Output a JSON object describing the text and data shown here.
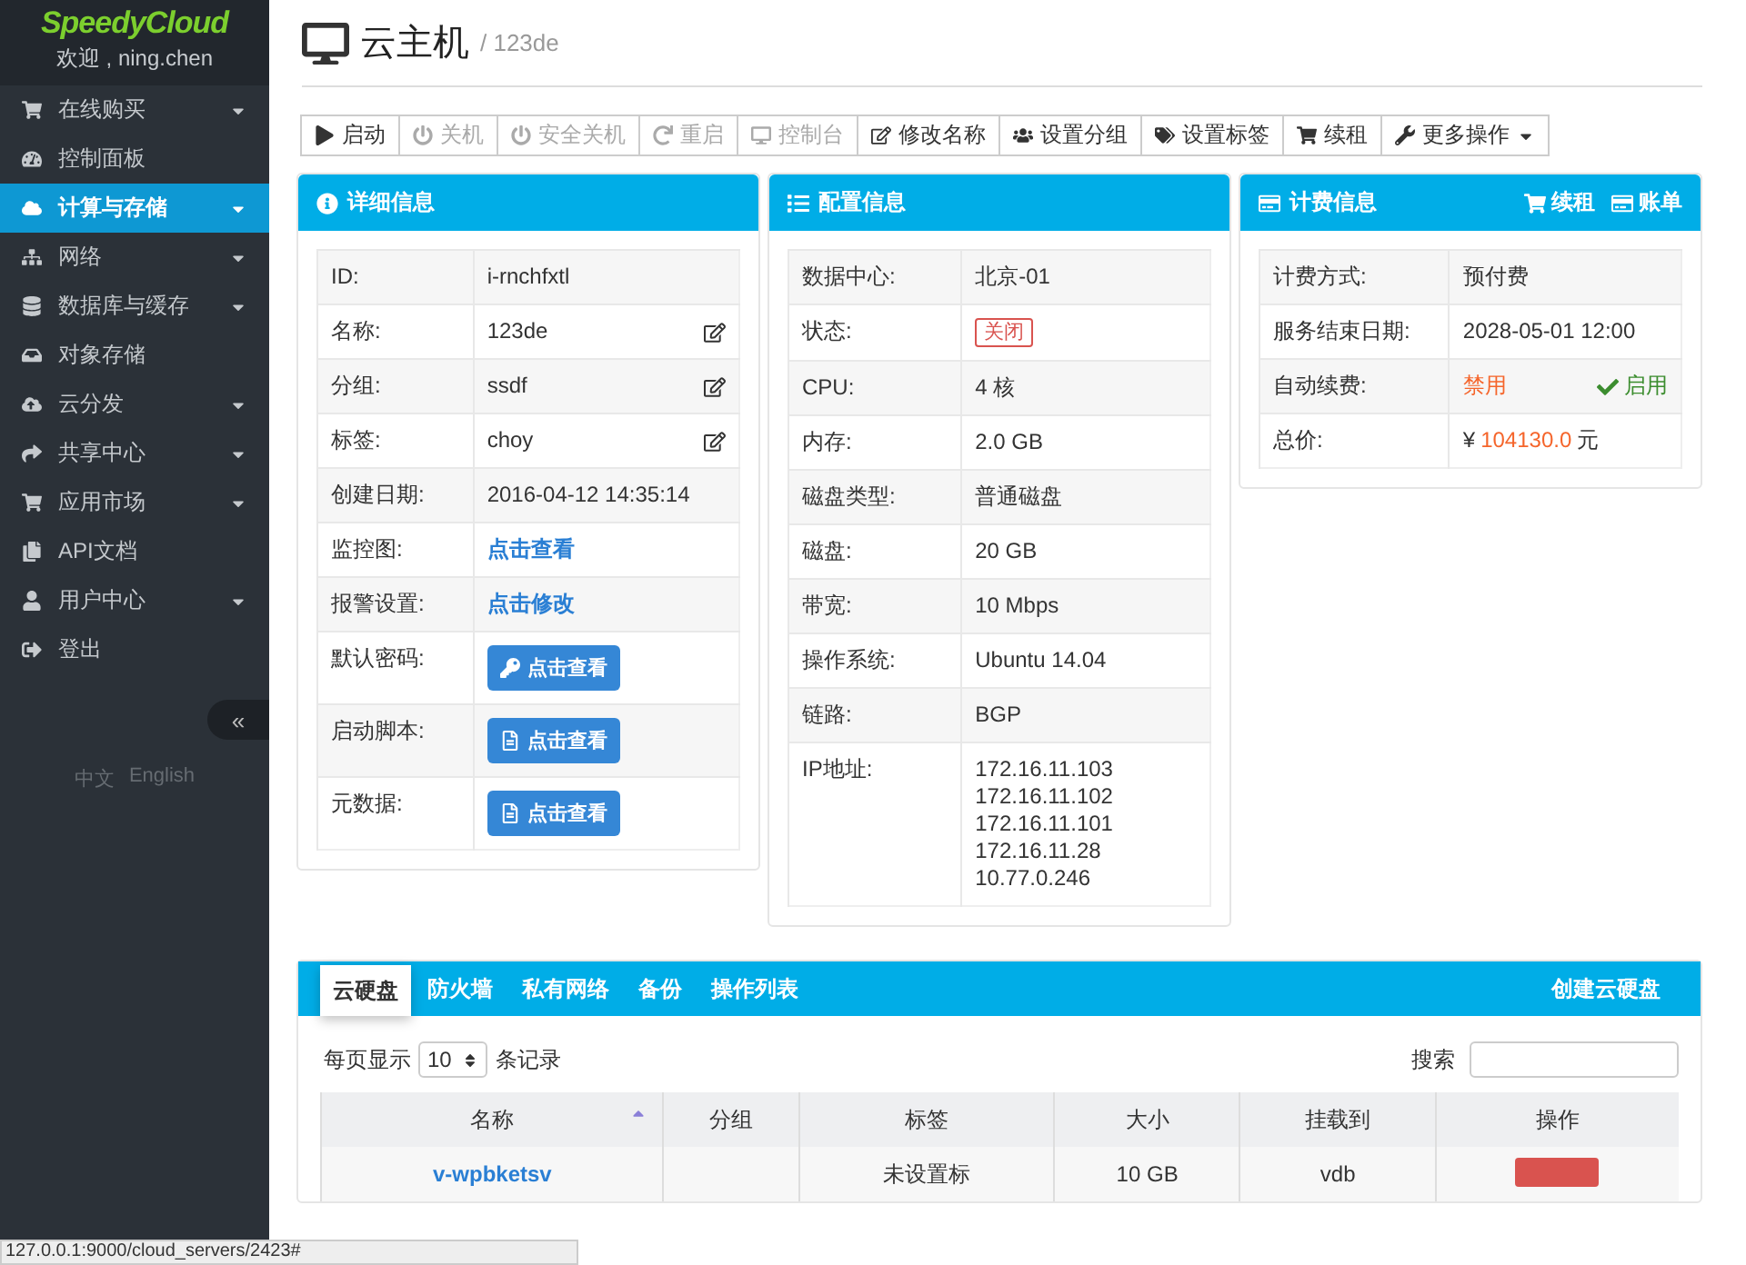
{
  "sidebar": {
    "logo": "SpeedyCloud",
    "welcome": "欢迎 , ning.chen",
    "items": [
      {
        "label": "在线购买",
        "expandable": true,
        "selected": false
      },
      {
        "label": "控制面板",
        "expandable": false,
        "selected": false
      },
      {
        "label": "计算与存储",
        "expandable": true,
        "selected": true
      },
      {
        "label": "网络",
        "expandable": true,
        "selected": false
      },
      {
        "label": "数据库与缓存",
        "expandable": true,
        "selected": false
      },
      {
        "label": "对象存储",
        "expandable": false,
        "selected": false
      },
      {
        "label": "云分发",
        "expandable": true,
        "selected": false
      },
      {
        "label": "共享中心",
        "expandable": true,
        "selected": false
      },
      {
        "label": "应用市场",
        "expandable": true,
        "selected": false
      },
      {
        "label": "API文档",
        "expandable": false,
        "selected": false
      },
      {
        "label": "用户中心",
        "expandable": true,
        "selected": false
      },
      {
        "label": "登出",
        "expandable": false,
        "selected": false
      }
    ],
    "collapse": "«",
    "languages": [
      "中文",
      "English"
    ]
  },
  "header": {
    "title": "云主机",
    "subtitle": "/ 123de"
  },
  "toolbar": [
    {
      "label": "启动",
      "disabled": false
    },
    {
      "label": "关机",
      "disabled": true
    },
    {
      "label": "安全关机",
      "disabled": true
    },
    {
      "label": "重启",
      "disabled": true
    },
    {
      "label": "控制台",
      "disabled": true
    },
    {
      "label": "修改名称",
      "disabled": false
    },
    {
      "label": "设置分组",
      "disabled": false
    },
    {
      "label": "设置标签",
      "disabled": false
    },
    {
      "label": "续租",
      "disabled": false
    },
    {
      "label": "更多操作",
      "disabled": false
    }
  ],
  "detail": {
    "title": "详细信息",
    "rows": [
      {
        "label": "ID:",
        "value": "i-rnchfxtl",
        "kind": "text"
      },
      {
        "label": "名称:",
        "value": "123de",
        "kind": "editable"
      },
      {
        "label": "分组:",
        "value": "ssdf",
        "kind": "editable"
      },
      {
        "label": "标签:",
        "value": "choy",
        "kind": "editable"
      },
      {
        "label": "创建日期:",
        "value": "2016-04-12 14:35:14",
        "kind": "text"
      },
      {
        "label": "监控图:",
        "value": "点击查看",
        "kind": "link"
      },
      {
        "label": "报警设置:",
        "value": "点击修改",
        "kind": "link"
      },
      {
        "label": "默认密码:",
        "value": "点击查看",
        "kind": "key-button"
      },
      {
        "label": "启动脚本:",
        "value": "点击查看",
        "kind": "file-button"
      },
      {
        "label": "元数据:",
        "value": "点击查看",
        "kind": "file-button"
      }
    ]
  },
  "config": {
    "title": "配置信息",
    "rows": [
      {
        "label": "数据中心:",
        "values": [
          "北京-01"
        ],
        "kind": "text"
      },
      {
        "label": "状态:",
        "values": [
          "关闭"
        ],
        "kind": "status"
      },
      {
        "label": "CPU:",
        "values": [
          "4 核"
        ],
        "kind": "text"
      },
      {
        "label": "内存:",
        "values": [
          "2.0 GB"
        ],
        "kind": "text"
      },
      {
        "label": "磁盘类型:",
        "values": [
          "普通磁盘"
        ],
        "kind": "text"
      },
      {
        "label": "磁盘:",
        "values": [
          "20 GB"
        ],
        "kind": "text"
      },
      {
        "label": "带宽:",
        "values": [
          "10 Mbps"
        ],
        "kind": "text"
      },
      {
        "label": "操作系统:",
        "values": [
          "Ubuntu 14.04"
        ],
        "kind": "text"
      },
      {
        "label": "链路:",
        "values": [
          "BGP"
        ],
        "kind": "text"
      },
      {
        "label": "IP地址:",
        "values": [
          "172.16.11.103",
          "172.16.11.102",
          "172.16.11.101",
          "172.16.11.28",
          "10.77.0.246"
        ],
        "kind": "text"
      }
    ]
  },
  "billing": {
    "title": "计费信息",
    "actions": [
      "续租",
      "账单"
    ],
    "rows": [
      {
        "label": "计费方式:",
        "value": "预付费",
        "kind": "text"
      },
      {
        "label": "服务结束日期:",
        "value": "2028-05-01 12:00",
        "kind": "text"
      },
      {
        "label": "自动续费:",
        "value": "禁用",
        "kind": "toggle",
        "toggle": "启用"
      },
      {
        "label": "总价:",
        "value": "104130.0",
        "kind": "price",
        "prefix": "¥",
        "suffix": "元"
      }
    ]
  },
  "disks": {
    "tabs": [
      {
        "label": "云硬盘",
        "selected": true
      },
      {
        "label": "防火墙",
        "selected": false
      },
      {
        "label": "私有网络",
        "selected": false
      },
      {
        "label": "备份",
        "selected": false
      },
      {
        "label": "操作列表",
        "selected": false
      }
    ],
    "create": "创建云硬盘",
    "length_before": "每页显示",
    "length_value": "10",
    "length_after": "条记录",
    "search_label": "搜索",
    "columns": [
      {
        "label": "名称",
        "sorted": true
      },
      {
        "label": "分组",
        "sorted": false
      },
      {
        "label": "标签",
        "sorted": false
      },
      {
        "label": "大小",
        "sorted": false
      },
      {
        "label": "挂载到",
        "sorted": false
      },
      {
        "label": "操作",
        "sorted": false
      }
    ],
    "rows": [
      {
        "name": "v-wpbketsv",
        "tag": "未设置标",
        "size": "10 GB",
        "mount": "vdb"
      }
    ]
  },
  "status_bar": "127.0.0.1:9000/cloud_servers/2423#"
}
